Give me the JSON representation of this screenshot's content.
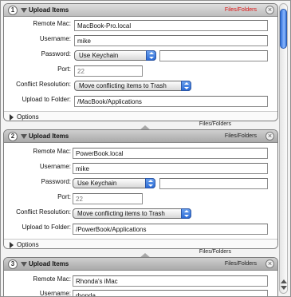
{
  "actions": [
    {
      "number": "1",
      "title": "Upload Items",
      "type": "Files/Folders",
      "remote_mac_label": "Remote Mac:",
      "remote_mac": "MacBook-Pro.local",
      "username_label": "Username:",
      "username": "mike",
      "password_label": "Password:",
      "password_option": "Use Keychain",
      "port_label": "Port:",
      "port_placeholder": "22",
      "conflict_label": "Conflict Resolution:",
      "conflict_option": "Move conflicting items to Trash",
      "upload_label": "Upload to Folder:",
      "upload_folder": "/MacBook/Applications",
      "options_label": "Options"
    },
    {
      "number": "2",
      "title": "Upload Items",
      "type": "Files/Folders",
      "remote_mac_label": "Remote Mac:",
      "remote_mac": "PowerBook.local",
      "username_label": "Username:",
      "username": "mike",
      "password_label": "Password:",
      "password_option": "Use Keychain",
      "port_label": "Port:",
      "port_placeholder": "22",
      "conflict_label": "Conflict Resolution:",
      "conflict_option": "Move conflicting items to Trash",
      "upload_label": "Upload to Folder:",
      "upload_folder": "/PowerBook/Applications",
      "options_label": "Options"
    },
    {
      "number": "3",
      "title": "Upload Items",
      "type": "Files/Folders",
      "remote_mac_label": "Remote Mac:",
      "remote_mac": "Rhonda's iMac",
      "username_label": "Username:",
      "username": "rhonda"
    }
  ],
  "connectors": [
    {
      "label": "Files/Folders"
    },
    {
      "label": "Files/Folders"
    }
  ],
  "colors": {
    "first_type_accent": "#dd1111",
    "popup_accent": "#2b6bd6",
    "scroll_thumb": "#3a77da"
  },
  "icons": {
    "close": "x-circle",
    "disclosure": "triangle-down",
    "options_toggle": "triangle-right",
    "popup": "up-down-arrows"
  }
}
